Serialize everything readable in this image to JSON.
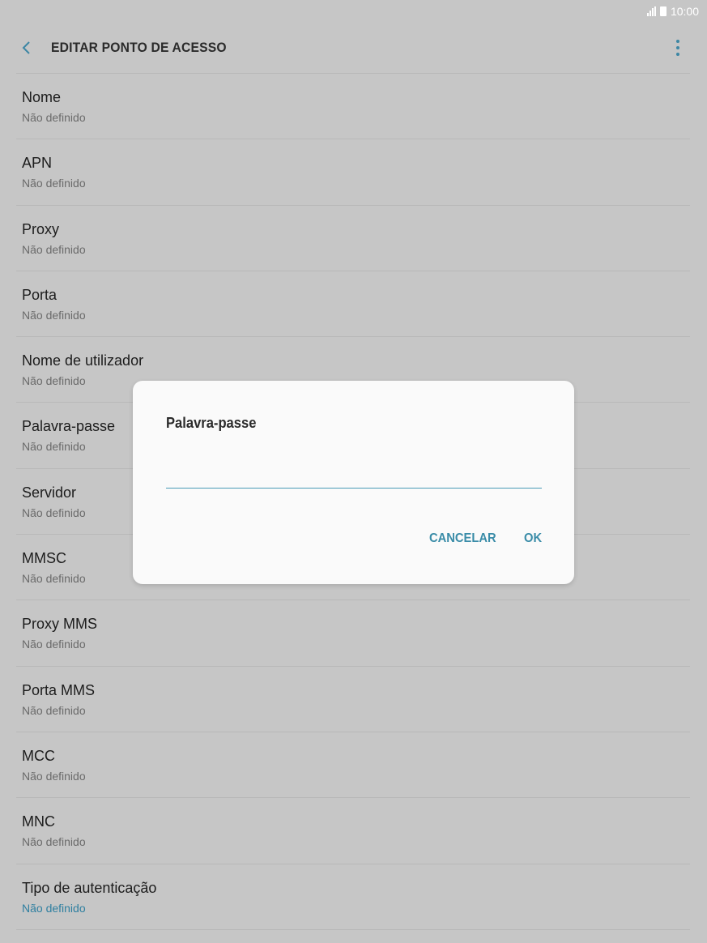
{
  "status_bar": {
    "time": "10:00"
  },
  "app_bar": {
    "title": "EDITAR PONTO DE ACESSO"
  },
  "settings": [
    {
      "title": "Nome",
      "value": "Não definido"
    },
    {
      "title": "APN",
      "value": "Não definido"
    },
    {
      "title": "Proxy",
      "value": "Não definido"
    },
    {
      "title": "Porta",
      "value": "Não definido"
    },
    {
      "title": "Nome de utilizador",
      "value": "Não definido"
    },
    {
      "title": "Palavra-passe",
      "value": "Não definido"
    },
    {
      "title": "Servidor",
      "value": "Não definido"
    },
    {
      "title": "MMSC",
      "value": "Não definido"
    },
    {
      "title": "Proxy MMS",
      "value": "Não definido"
    },
    {
      "title": "Porta MMS",
      "value": "Não definido"
    },
    {
      "title": "MCC",
      "value": "Não definido"
    },
    {
      "title": "MNC",
      "value": "Não definido"
    },
    {
      "title": "Tipo de autenticação",
      "value": "Não definido"
    }
  ],
  "dialog": {
    "title": "Palavra-passe",
    "input_value": "",
    "cancel_label": "CANCELAR",
    "ok_label": "OK"
  },
  "colors": {
    "accent": "#3a8ca8",
    "background_dim": "#c6c6c6",
    "dialog_bg": "#fafafa"
  }
}
